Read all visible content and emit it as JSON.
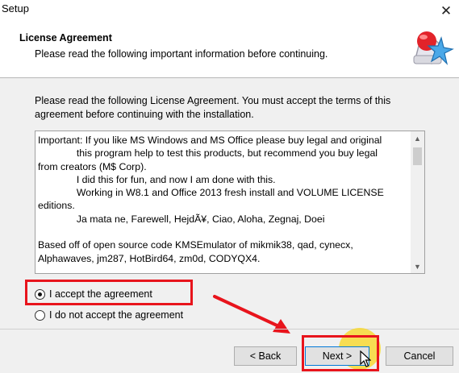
{
  "window": {
    "title": "Setup"
  },
  "header": {
    "title": "License Agreement",
    "subtitle": "Please read the following important information before continuing."
  },
  "intro": "Please read the following License Agreement. You must accept the terms of this agreement before continuing with the installation.",
  "license": {
    "lines": [
      "Important: If you like MS Windows and MS Office please buy legal and original",
      "              this program help to test this products, but recommend you buy legal",
      "from creators (M$ Corp).",
      "              I did this for fun, and now I am done with this.",
      "              Working in W8.1 and Office 2013 fresh install and VOLUME LICENSE",
      "editions.",
      "              Ja mata ne, Farewell, HejdÃ¥, Ciao, Aloha, Zegnaj, Doei",
      "",
      "Based off of open source code KMSEmulator of mikmik38, qad, cynecx,",
      "Alphawaves, jm287, HotBird64, zm0d, CODYQX4."
    ]
  },
  "options": {
    "accept": "I accept the agreement",
    "decline": "I do not accept the agreement",
    "selected": "accept"
  },
  "buttons": {
    "back": "< Back",
    "next": "Next >",
    "cancel": "Cancel"
  },
  "icons": {
    "close": "close-icon",
    "wizard": "setup-wizard-icon",
    "scroll_up": "scroll-up-icon",
    "scroll_down": "scroll-down-icon",
    "cursor": "mouse-cursor-icon"
  },
  "colors": {
    "annotation": "#e8141c",
    "cursor_highlight": "#fad71e",
    "focus": "#0078d7"
  }
}
